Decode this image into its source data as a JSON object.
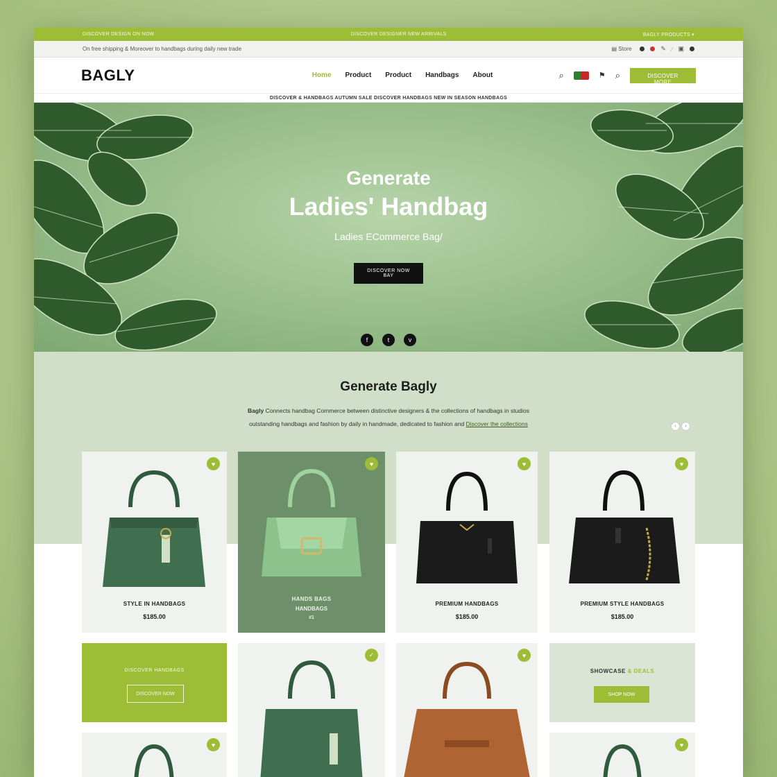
{
  "promo_bar": {
    "left": "DISCOVER DESIGN ON NOW",
    "center": "DISCOVER DESIGNER NEW ARRIVALS",
    "right": "BAGLY PRODUCTS ▾"
  },
  "utility_bar": {
    "text": "On free shipping & Moreover to handbags during daily new trade",
    "store_label": "Store"
  },
  "header": {
    "logo": "BAGLY",
    "nav": [
      "Home",
      "Product",
      "Product",
      "Handbags",
      "About"
    ],
    "cta_label": "DISCOVER MORE"
  },
  "ticker": "DISCOVER & HANDBAGS AUTUMN SALE DISCOVER HANDBAGS NEW IN SEASON HANDBAGS",
  "hero": {
    "line1": "Generate",
    "line2": "Ladies' Handbag",
    "subtitle": "Ladies ECommerce Bag/",
    "button": "DISCOVER NOW BAY",
    "socials": [
      "f",
      "t",
      "v"
    ]
  },
  "intro": {
    "title": "Generate Bagly",
    "line1_lead": "Bagly",
    "line1": "Connects handbag Commerce between distinctive designers & the collections of handbags in studios",
    "line2": "outstanding handbags and fashion by daily in handmade, dedicated to fashion and",
    "line2_link": "Discover the collections",
    "pager": [
      "‹",
      "›"
    ]
  },
  "products": [
    {
      "name": "STYLE IN HANDBAGS",
      "price": "$185.00",
      "color": "#3f6f4f",
      "fav_icon": "heart-icon"
    },
    {
      "name": "HANDS BAGS",
      "price": "HANDBAGS",
      "extra": "#1",
      "color": "#8cc38c",
      "fav_icon": "heart-icon"
    },
    {
      "name": "PREMIUM HANDBAGS",
      "price": "$185.00",
      "color": "#1b1b1b",
      "fav_icon": "heart-icon"
    },
    {
      "name": "PREMIUM STYLE HANDBAGS",
      "price": "$185.00",
      "color": "#1b1b1b",
      "fav_icon": "heart-icon"
    }
  ],
  "promo_cards": [
    {
      "title": "DISCOVER HANDBAGS",
      "button": "DISCOVER NOW"
    },
    {
      "title_a": "SHOWCASE",
      "title_b": "& DEALS",
      "button": "SHOP NOW"
    }
  ],
  "row2_products": [
    {
      "color": "#3f6f4f",
      "fav_icon": "check-icon"
    },
    {
      "color": "#b06433",
      "fav_icon": "heart-icon"
    }
  ],
  "row3_products": [
    {
      "color": "#3f6f4f",
      "fav_icon": "heart-icon"
    },
    {
      "color": "#3f6f4f",
      "fav_icon": "heart-icon"
    }
  ],
  "colors": {
    "accent": "#9ebd36",
    "hero_bg": "#9cc18e",
    "band_bg": "#d2dfc8"
  }
}
